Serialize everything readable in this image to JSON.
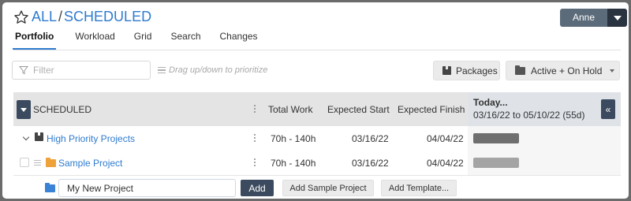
{
  "header": {
    "crumb_root": "ALL",
    "crumb_sep": "/",
    "crumb_current": "SCHEDULED",
    "user_name": "Anne"
  },
  "tabs": [
    {
      "label": "Portfolio",
      "active": true
    },
    {
      "label": "Workload",
      "active": false
    },
    {
      "label": "Grid",
      "active": false
    },
    {
      "label": "Search",
      "active": false
    },
    {
      "label": "Changes",
      "active": false
    }
  ],
  "toolbar": {
    "filter_placeholder": "Filter",
    "drag_hint": "Drag up/down to prioritize",
    "packages_label": "Packages",
    "status_filter_label": "Active + On Hold"
  },
  "grid": {
    "columns": {
      "name": "SCHEDULED",
      "total_work": "Total Work",
      "expected_start": "Expected Start",
      "expected_finish": "Expected Finish"
    },
    "today_title": "Today...",
    "today_range": "03/16/22 to 05/10/22 (55d)",
    "expand_label": "«",
    "rows": [
      {
        "name": "High Priority Projects",
        "kind": "package",
        "total_work": "70h - 140h",
        "expected_start": "03/16/22",
        "expected_finish": "04/04/22",
        "bar_color": "#6f6f6f"
      },
      {
        "name": "Sample Project",
        "kind": "project",
        "total_work": "70h - 140h",
        "expected_start": "03/16/22",
        "expected_finish": "04/04/22",
        "bar_color": "#a4a4a4"
      }
    ]
  },
  "new_project": {
    "input_value": "My New Project",
    "add_label": "Add",
    "add_sample_label": "Add Sample Project",
    "add_template_label": "Add Template..."
  }
}
